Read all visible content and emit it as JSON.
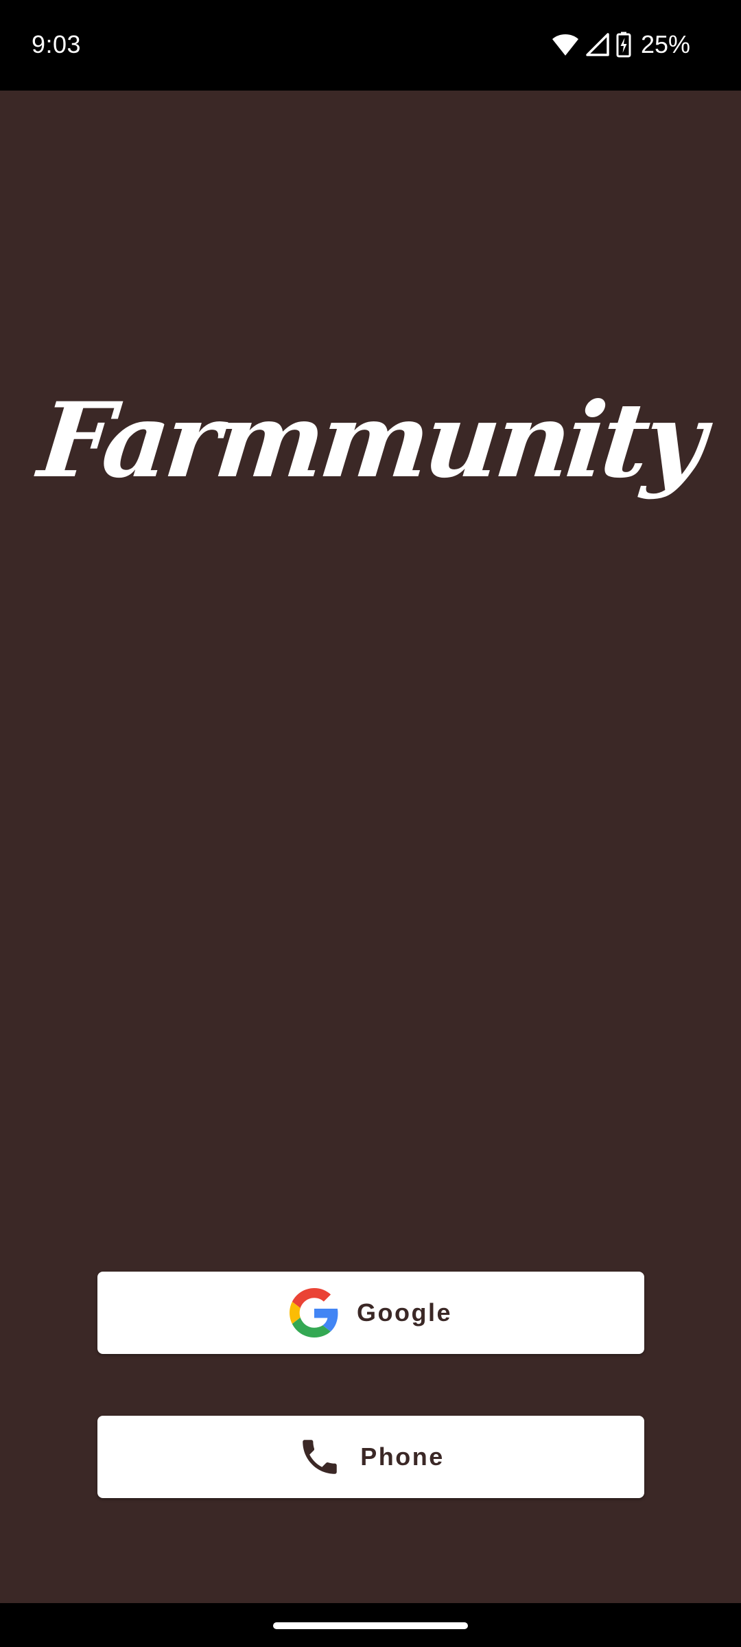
{
  "status_bar": {
    "time": "9:03",
    "battery_percent": "25%",
    "icons": [
      "wifi-icon",
      "signal-icon",
      "battery-charging-icon"
    ]
  },
  "app": {
    "logo_text": "Farmmunity",
    "background_color": "#3b2826",
    "text_color": "#ffffff"
  },
  "auth": {
    "google_label": "Google",
    "google_icon": "google-logo-icon",
    "phone_label": "Phone",
    "phone_icon": "phone-icon",
    "button_background": "#ffffff",
    "button_text_color": "#3b2826"
  }
}
